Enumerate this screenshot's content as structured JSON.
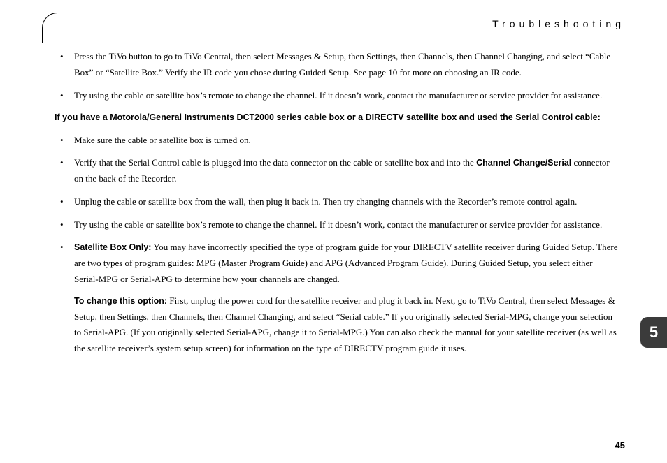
{
  "header": {
    "title": "Troubleshooting"
  },
  "bullets_top": [
    "Press the TiVo button to go to TiVo Central, then select Messages & Setup, then Settings, then Channels, then Channel Changing, and select “Cable Box” or “Satellite Box.” Verify the IR code you chose during Guided Setup. See page 10 for more on choosing an IR code.",
    "Try using the cable or satellite box’s remote to change the channel. If it doesn’t work, contact the manufacturer or service provider for assistance."
  ],
  "condition": "If you have a Motorola/General Instruments DCT2000 series cable box or a DIRECTV satellite box and used the Serial Control cable:",
  "bullets_mid": {
    "b1": "Make sure the cable or satellite box is turned on.",
    "b2_pre": "Verify that the Serial Control cable is plugged into the data connector on the cable or satellite box and into the ",
    "b2_bold": "Channel Change/Serial",
    "b2_post": " connector on the back of the Recorder.",
    "b3": "Unplug the cable or satellite box from the wall, then plug it back in. Then try changing channels with the Recorder’s remote control again.",
    "b4": "Try using the cable or satellite box’s remote to change the channel. If it doesn’t work, contact the manufacturer or service provider for assistance.",
    "b5_label": "Satellite Box Only:",
    "b5_text": " You may have incorrectly specified the type of program guide for your DIRECTV satellite receiver during Guided Setup. There are two types of program guides: MPG (Master Program Guide) and APG (Advanced Program Guide). During Guided Setup, you select either Serial-MPG or Serial-APG to determine how your channels are changed.",
    "b5_sub_label": "To change this option:",
    "b5_sub_text": " First, unplug the power cord for the satellite receiver and plug it back in. Next, go to TiVo Central, then select Messages & Setup, then Settings, then Channels, then Channel Changing, and select “Serial cable.” If you originally selected Serial-MPG, change your selection to Serial-APG. (If you originally selected Serial-APG, change it to Serial-MPG.) You can also check the manual for your satellite receiver (as well as the satellite receiver’s system setup screen) for information on the type of DIRECTV program guide it uses."
  },
  "chapter_tab": "5",
  "page_number": "45"
}
